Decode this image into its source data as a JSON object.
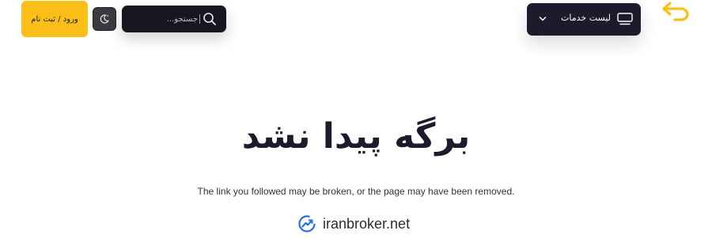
{
  "header": {
    "login_label": "ورود / ثبت نام",
    "search_placeholder": "جستجو...",
    "services_label": "لیست خدمات"
  },
  "main": {
    "title": "برگه پیدا نشد",
    "message": "The link you followed may be broken, or the page may have been removed.",
    "brand": "iranbroker.net"
  },
  "colors": {
    "accent": "#fbbf17",
    "dark_navy": "#1c1b2c",
    "brand_blue": "#2b6fe6"
  },
  "icons": [
    "search-icon",
    "moon-icon",
    "monitor-icon",
    "chevron-down-icon",
    "back-arrow-icon",
    "brand-logo-icon"
  ]
}
